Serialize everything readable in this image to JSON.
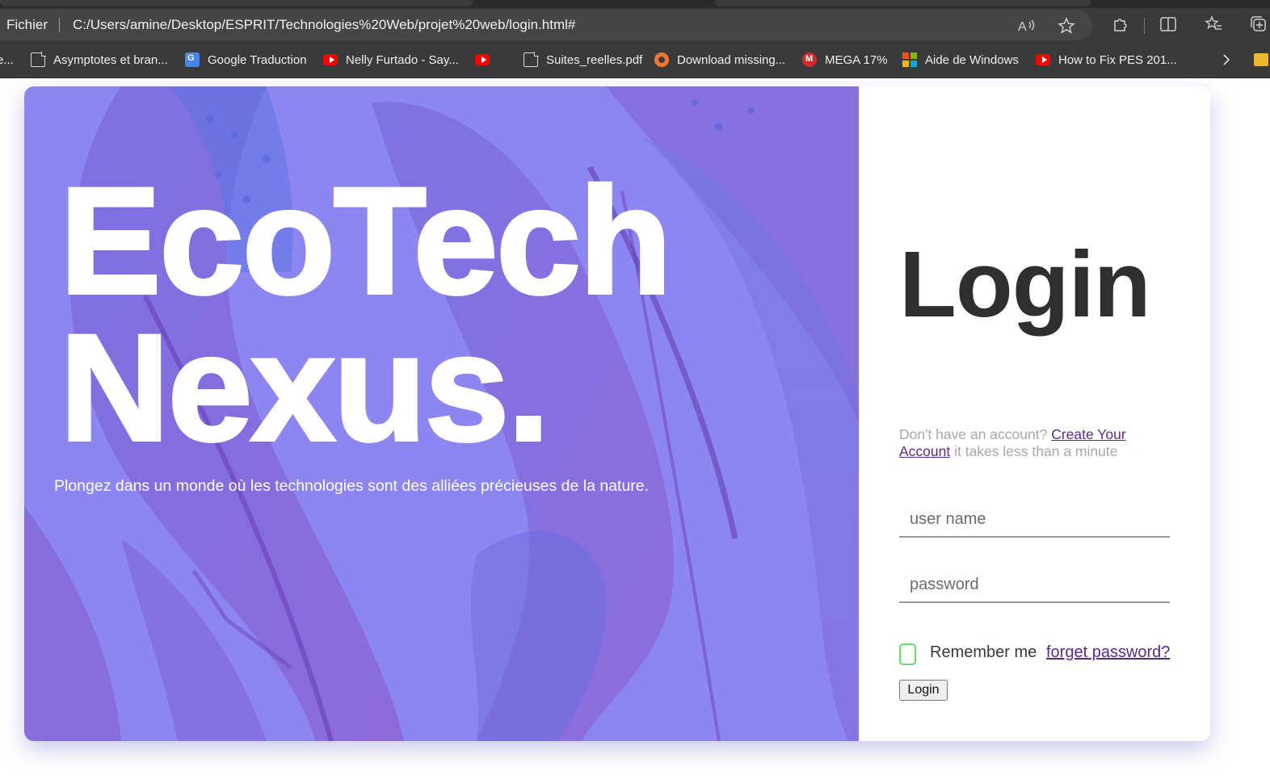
{
  "browser": {
    "scheme_label": "Fichier",
    "url": "C:/Users/amine/Desktop/ESPRIT/Technologies%20Web/projet%20web/login.html#",
    "toolbar_icons": [
      "read-aloud-icon",
      "favorite-star-icon",
      "extensions-icon",
      "split-screen-icon",
      "favorites-icon",
      "collections-icon"
    ],
    "bookmarks": [
      {
        "label": "e...",
        "icon": "none"
      },
      {
        "label": "Asymptotes et bran...",
        "icon": "document-icon"
      },
      {
        "label": "Google Traduction",
        "icon": "google-translate-icon"
      },
      {
        "label": "Nelly Furtado - Say...",
        "icon": "youtube-icon"
      },
      {
        "label": "",
        "icon": "youtube-icon"
      },
      {
        "label": "Suites_reelles.pdf",
        "icon": "document-icon"
      },
      {
        "label": "Download missing...",
        "icon": "download-gear-icon"
      },
      {
        "label": "MEGA 17%",
        "icon": "mega-icon"
      },
      {
        "label": "Aide de Windows",
        "icon": "windows-icon"
      },
      {
        "label": "How to Fix PES 201...",
        "icon": "youtube-icon"
      }
    ],
    "overflow_icon": "chevron-right-icon",
    "folder_icon": "folder-icon"
  },
  "hero": {
    "brand_line1": "EcoTech",
    "brand_line2": "Nexus.",
    "tagline": "Plongez dans un monde où les technologies sont des alliées précieuses de la nature.",
    "background_color": "#8e86f0"
  },
  "login": {
    "title": "Login",
    "signup_prefix": "Don't have an account?",
    "signup_link": "Create Your Account",
    "signup_suffix": "it takes less than a minute",
    "username_placeholder": "user name",
    "password_placeholder": "password",
    "remember_label": "Remember me",
    "forget_link": "forget password?",
    "submit_label": "Login",
    "checkbox_color": "#5ee06a",
    "link_color": "#5a2a8a"
  }
}
